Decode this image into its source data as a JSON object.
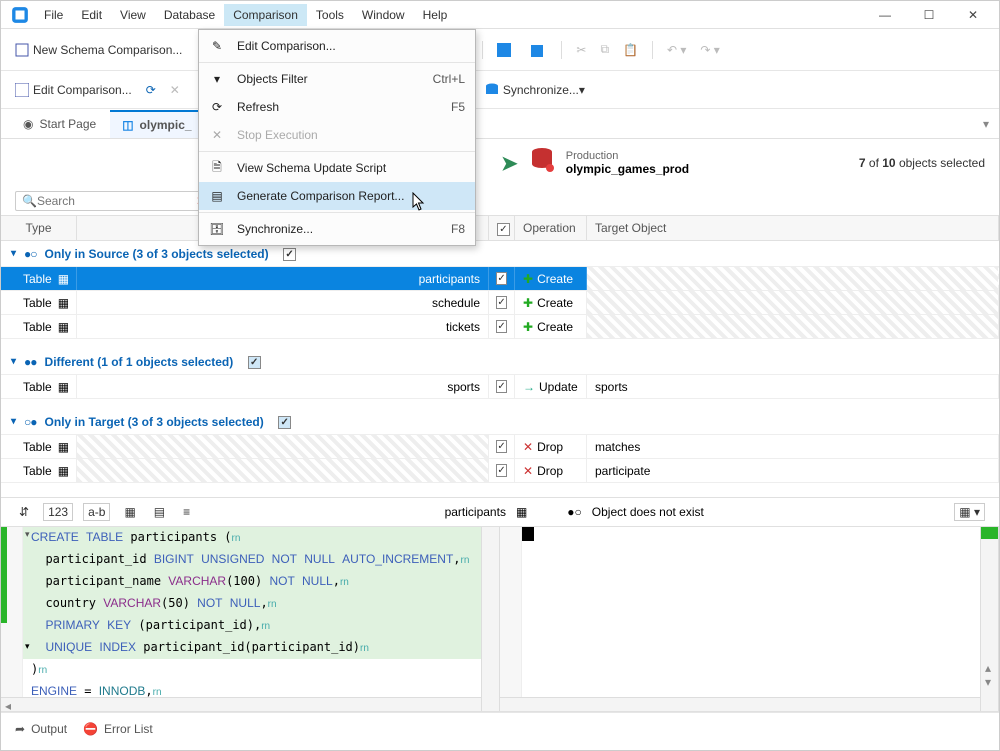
{
  "menu": {
    "file": "File",
    "edit": "Edit",
    "view": "View",
    "database": "Database",
    "comparison": "Comparison",
    "tools": "Tools",
    "window": "Window",
    "help": "Help"
  },
  "window": {
    "min": "—",
    "max": "☐",
    "close": "✕"
  },
  "popup": {
    "edit_comparison": "Edit Comparison...",
    "objects_filter": "Objects Filter",
    "objects_filter_sc": "Ctrl+L",
    "refresh": "Refresh",
    "refresh_sc": "F5",
    "stop_execution": "Stop Execution",
    "view_script": "View Schema Update Script",
    "gen_report": "Generate Comparison Report...",
    "synchronize": "Synchronize...",
    "synchronize_sc": "F8"
  },
  "toolbar": {
    "new_schema": "New Schema Comparison...",
    "edit_comparison": "Edit Comparison...",
    "synchronize": "Synchronize..."
  },
  "tabs": {
    "start_page": "Start Page",
    "active": "olympic_"
  },
  "prod": {
    "label": "Production",
    "name": "olympic_games_prod"
  },
  "selection": {
    "prefix": "7",
    "mid": " of ",
    "count": "10",
    "suffix": " objects selected"
  },
  "search": {
    "placeholder": "Search",
    "clear": "✕"
  },
  "headers": {
    "type": "Type",
    "operation": "Operation",
    "target": "Target Object"
  },
  "groups": {
    "only_source": "Only in Source (3 of 3 objects selected)",
    "different": "Different (1 of 1 objects selected)",
    "only_target": "Only in Target (3 of 3 objects selected)"
  },
  "type_label": "Table",
  "rows": {
    "r1_src": "participants",
    "r1_op": "Create",
    "r2_src": "schedule",
    "r2_op": "Create",
    "r3_src": "tickets",
    "r3_op": "Create",
    "r4_src": "sports",
    "r4_op": "Update",
    "r4_tgt": "sports",
    "r5_op": "Drop",
    "r5_tgt": "matches",
    "r6_op": "Drop",
    "r6_tgt": "participate"
  },
  "diff": {
    "left_label": "participants",
    "right_label": "Object does not exist",
    "abc": "a-b"
  },
  "status": {
    "output": "Output",
    "error_list": "Error List"
  }
}
